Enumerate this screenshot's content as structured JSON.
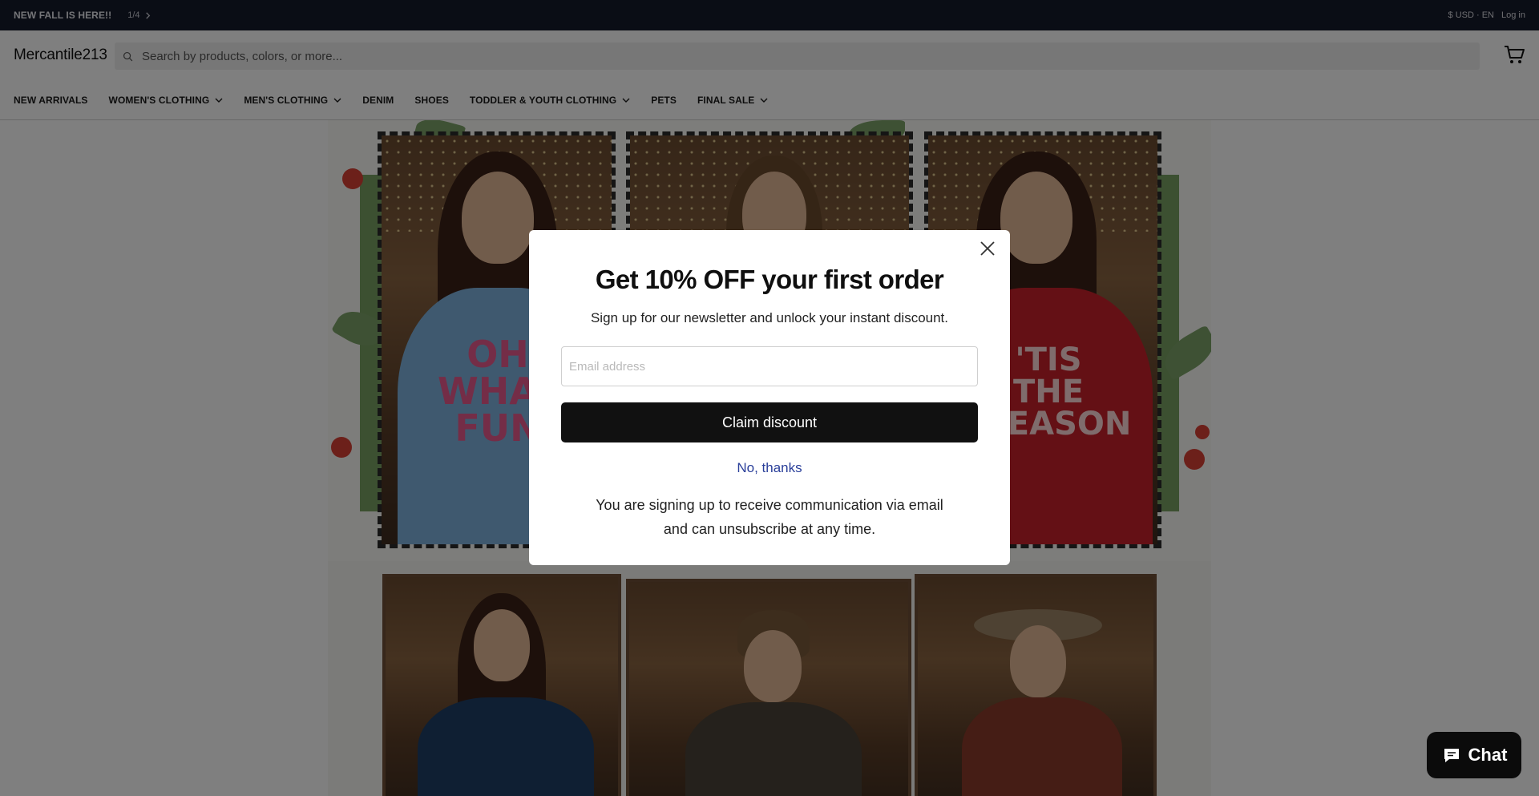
{
  "announcement": {
    "message": "NEW FALL IS HERE!!",
    "counter": "1/4",
    "currency": "$ USD · EN",
    "login": "Log in"
  },
  "header": {
    "logo": "Mercantile213",
    "search_placeholder": "Search by products, colors, or more..."
  },
  "nav": {
    "items": [
      {
        "label": "NEW ARRIVALS",
        "dropdown": false
      },
      {
        "label": "WOMEN'S CLOTHING",
        "dropdown": true
      },
      {
        "label": "MEN'S CLOTHING",
        "dropdown": true
      },
      {
        "label": "DENIM",
        "dropdown": false
      },
      {
        "label": "SHOES",
        "dropdown": false
      },
      {
        "label": "TODDLER & YOUTH CLOTHING",
        "dropdown": true
      },
      {
        "label": "PETS",
        "dropdown": false
      },
      {
        "label": "FINAL SALE",
        "dropdown": true
      }
    ]
  },
  "hero": {
    "sweater_left": "OH WHAT FUN",
    "sweater_right": "'TIS THE SEASON"
  },
  "modal": {
    "title": "Get 10% OFF your first order",
    "subtitle": "Sign up for our newsletter and unlock your instant discount.",
    "email_placeholder": "Email address",
    "claim_label": "Claim discount",
    "decline_label": "No, thanks",
    "fine_print": "You are signing up to receive communication via email and can unsubscribe at any time."
  },
  "chat": {
    "label": "Chat"
  },
  "colors": {
    "announcement_bg": "#151a2b",
    "primary_button": "#111111",
    "link": "#2a3f9a"
  }
}
